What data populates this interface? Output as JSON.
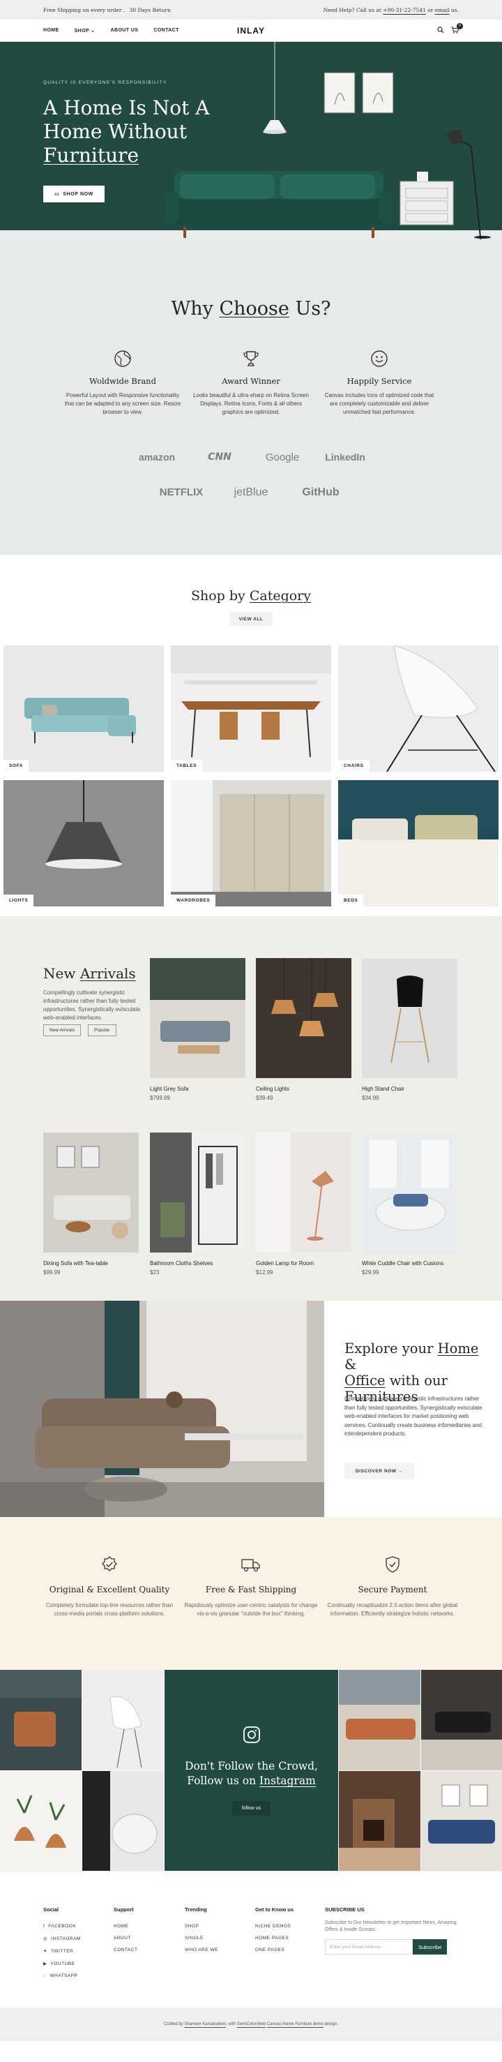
{
  "topbar": {
    "left1": "Free Shipping on every order .",
    "left2": "30 Days Return",
    "right_prefix": "Need Help? Call us at ",
    "phone": "+90-31-22-7541",
    "or": " or ",
    "email": "email",
    "right_suffix": " us."
  },
  "nav": {
    "items": [
      "HOME",
      "SHOP",
      "ABOUT US",
      "CONTACT"
    ],
    "logo": "INLAY",
    "cart_count": "0"
  },
  "hero": {
    "kicker": "QUALITY IS EVERYONE'S RESPONSIBILITY",
    "title1": "A Home Is Not A",
    "title2": "Home Without",
    "title3": "Furniture",
    "button": "SHOP NOW"
  },
  "why": {
    "title_a": "Why ",
    "title_b": "Choose",
    "title_c": " Us?",
    "features": [
      {
        "icon": "globe-icon",
        "title": "Woldwide Brand",
        "text": "Powerful Layout with Responsive functionality that can be adapted to any screen size. Resize browser to view."
      },
      {
        "icon": "trophy-icon",
        "title": "Award Winner",
        "text": "Looks beautiful & ultra-sharp on Retina Screen Displays. Retina Icons, Fonts & all others graphics are optimized."
      },
      {
        "icon": "smiley-icon",
        "title": "Happily Service",
        "text": "Canvas includes tons of optimized code that are completely customizable and deliver unmatched fast performance."
      }
    ],
    "brands_row1": [
      "amazon",
      "CNN",
      "Google",
      "LinkedIn"
    ],
    "brands_row2": [
      "NETFLIX",
      "jetBlue",
      "GitHub"
    ]
  },
  "category": {
    "title_a": "Shop by ",
    "title_b": "Category",
    "view_all": "VIEW ALL",
    "items": [
      "SOFA",
      "TABLES",
      "CHAIRS",
      "LIGHTS",
      "WARDROBES",
      "BEDS"
    ]
  },
  "arrivals": {
    "title_a": "New ",
    "title_b": "Arrivals",
    "intro": "Compellingly cultivate synergistic infrastructures rather than fully tested opportunities. Synergistically evisculate web-enabled interfaces.",
    "tabs": [
      "New Arrivals",
      "Popular"
    ],
    "products": [
      {
        "name": "Light Grey Sofa",
        "price": "$799.99"
      },
      {
        "name": "Ceiling Lights",
        "price": "$39.49"
      },
      {
        "name": "High Stand Chair",
        "price": "$34.99"
      },
      {
        "name": "Dining Sofa with Tea-table",
        "price": "$99.99"
      },
      {
        "name": "Bathroom Cloths Shelves",
        "price": "$23"
      },
      {
        "name": "Golden Lamp for Room",
        "price": "$12.99"
      },
      {
        "name": "White Cuddle Chair with Cusions",
        "price": "$29.99"
      }
    ]
  },
  "explore": {
    "t1": "Explore your ",
    "t2": "Home",
    "t3": " &",
    "t4": "Office",
    "t5": " with our",
    "t6": "Furnitures",
    "text": "Compellingly cultivate synergistic infrastructures rather than fully tested opportunities. Synergistically evisculate web-enabled interfaces for market positioning web services. Continually create business infomediaries and interdependent products.",
    "button": "DISCOVER NOW →"
  },
  "quality": [
    {
      "icon": "badge-check-icon",
      "title": "Original & Excellent Quality",
      "text": "Completely formulate top-line resources rather than cross-media portals cross-platform solutions."
    },
    {
      "icon": "truck-icon",
      "title": "Free & Fast Shipping",
      "text": "Rapidiously optimize user-centric catalysts for change vis-a-vis granular \"outside the box\" thinking."
    },
    {
      "icon": "shield-check-icon",
      "title": "Secure Payment",
      "text": "Continually recaptiualize 2.0 action items after global information. Efficiently strategize holistic networks."
    }
  ],
  "instagram": {
    "line1": "Don't Follow the Crowd,",
    "line2a": "Follow us on ",
    "line2b": "Instagram",
    "button": "follow us"
  },
  "footer": {
    "cols": [
      {
        "head": "Social",
        "items": [
          "FACEBOOK",
          "INSTAGRAM",
          "TWITTER",
          "YOUTUBE",
          "WHATSAPP"
        ]
      },
      {
        "head": "Support",
        "items": [
          "HOME",
          "ABOUT",
          "CONTACT"
        ]
      },
      {
        "head": "Trending",
        "items": [
          "SHOP",
          "SINGLE",
          "WHO ARE WE"
        ]
      },
      {
        "head": "Get to Know us",
        "items": [
          "NICHE DEMOS",
          "HOME PAGES",
          "ONE PAGES"
        ]
      }
    ],
    "subscribe_head": "SUBSCRIBE US",
    "subscribe_text": "Subscribe to Our Newsletter to get Important News, Amazing Offers & Inside Scoops:",
    "email_placeholder": "Enter your Email Address",
    "subscribe_button": "Subscribe"
  },
  "copyright": {
    "a": "Crafted by ",
    "b": "Shameer Kamaludeen",
    "c": ", with ",
    "d": "SemiColonWeb",
    "e": " ",
    "f": "Canvas theme Furniture demo",
    "g": " design."
  }
}
